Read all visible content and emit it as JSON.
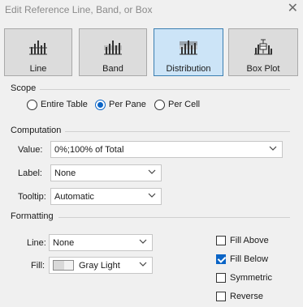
{
  "window": {
    "title": "Edit Reference Line, Band, or Box"
  },
  "types": [
    {
      "label": "Line",
      "icon": "reference-line-icon",
      "selected": false
    },
    {
      "label": "Band",
      "icon": "reference-band-icon",
      "selected": false
    },
    {
      "label": "Distribution",
      "icon": "reference-distribution-icon",
      "selected": true
    },
    {
      "label": "Box Plot",
      "icon": "box-plot-icon",
      "selected": false
    }
  ],
  "scope": {
    "heading": "Scope",
    "options": [
      {
        "label": "Entire Table",
        "selected": false
      },
      {
        "label": "Per Pane",
        "selected": true
      },
      {
        "label": "Per Cell",
        "selected": false
      }
    ]
  },
  "computation": {
    "heading": "Computation",
    "value_label": "Value:",
    "value": "0%;100% of Total",
    "label_label": "Label:",
    "label_value": "None",
    "tooltip_label": "Tooltip:",
    "tooltip_value": "Automatic"
  },
  "formatting": {
    "heading": "Formatting",
    "line_label": "Line:",
    "line_value": "None",
    "fill_label": "Fill:",
    "fill_value": "Gray Light",
    "checks": [
      {
        "label": "Fill Above",
        "checked": false
      },
      {
        "label": "Fill Below",
        "checked": true
      },
      {
        "label": "Symmetric",
        "checked": false
      },
      {
        "label": "Reverse",
        "checked": false
      }
    ]
  },
  "colors": {
    "selected_bg": "#cce4f7",
    "accent": "#0a64c6"
  }
}
